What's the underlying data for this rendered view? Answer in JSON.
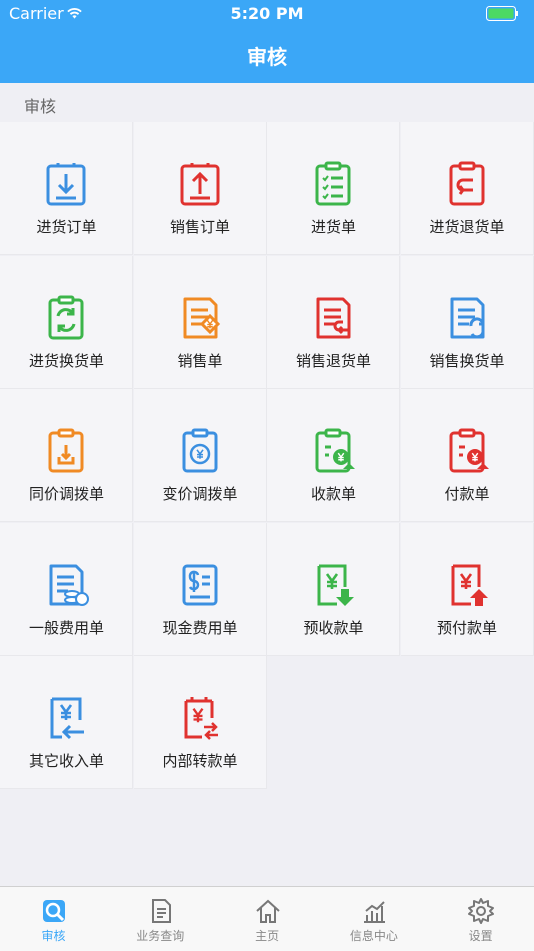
{
  "status": {
    "carrier": "Carrier",
    "time": "5:20 PM"
  },
  "nav": {
    "title": "审核"
  },
  "section_title": "审核",
  "items": [
    {
      "label": "进货订单",
      "icon": "download-clipboard-icon",
      "color": "#3b8fe0"
    },
    {
      "label": "销售订单",
      "icon": "upload-clipboard-icon",
      "color": "#e0322f"
    },
    {
      "label": "进货单",
      "icon": "checklist-clipboard-icon",
      "color": "#3cb54a"
    },
    {
      "label": "进货退货单",
      "icon": "return-clipboard-icon",
      "color": "#e0322f"
    },
    {
      "label": "进货换货单",
      "icon": "exchange-clipboard-icon",
      "color": "#3cb54a"
    },
    {
      "label": "销售单",
      "icon": "tag-document-icon",
      "color": "#f08a24"
    },
    {
      "label": "销售退货单",
      "icon": "return-document-icon",
      "color": "#e0322f"
    },
    {
      "label": "销售换货单",
      "icon": "exchange-document-icon",
      "color": "#3b8fe0"
    },
    {
      "label": "同价调拨单",
      "icon": "transfer-clipboard-icon",
      "color": "#f08a24"
    },
    {
      "label": "变价调拨单",
      "icon": "yuan-cycle-clipboard-icon",
      "color": "#3b8fe0"
    },
    {
      "label": "收款单",
      "icon": "receive-payment-icon",
      "color": "#3cb54a"
    },
    {
      "label": "付款单",
      "icon": "pay-out-icon",
      "color": "#e0322f"
    },
    {
      "label": "一般费用单",
      "icon": "general-expense-icon",
      "color": "#3b8fe0"
    },
    {
      "label": "现金费用单",
      "icon": "cash-expense-icon",
      "color": "#3b8fe0"
    },
    {
      "label": "预收款单",
      "icon": "advance-receive-icon",
      "color": "#3cb54a"
    },
    {
      "label": "预付款单",
      "icon": "advance-pay-icon",
      "color": "#e0322f"
    },
    {
      "label": "其它收入单",
      "icon": "other-income-icon",
      "color": "#3b8fe0"
    },
    {
      "label": "内部转款单",
      "icon": "internal-transfer-icon",
      "color": "#e0322f"
    }
  ],
  "tabs": [
    {
      "label": "审核",
      "icon": "audit-icon",
      "active": true
    },
    {
      "label": "业务查询",
      "icon": "document-icon",
      "active": false
    },
    {
      "label": "主页",
      "icon": "home-icon",
      "active": false
    },
    {
      "label": "信息中心",
      "icon": "chart-icon",
      "active": false
    },
    {
      "label": "设置",
      "icon": "gear-icon",
      "active": false
    }
  ],
  "accent": "#3ba7f7"
}
